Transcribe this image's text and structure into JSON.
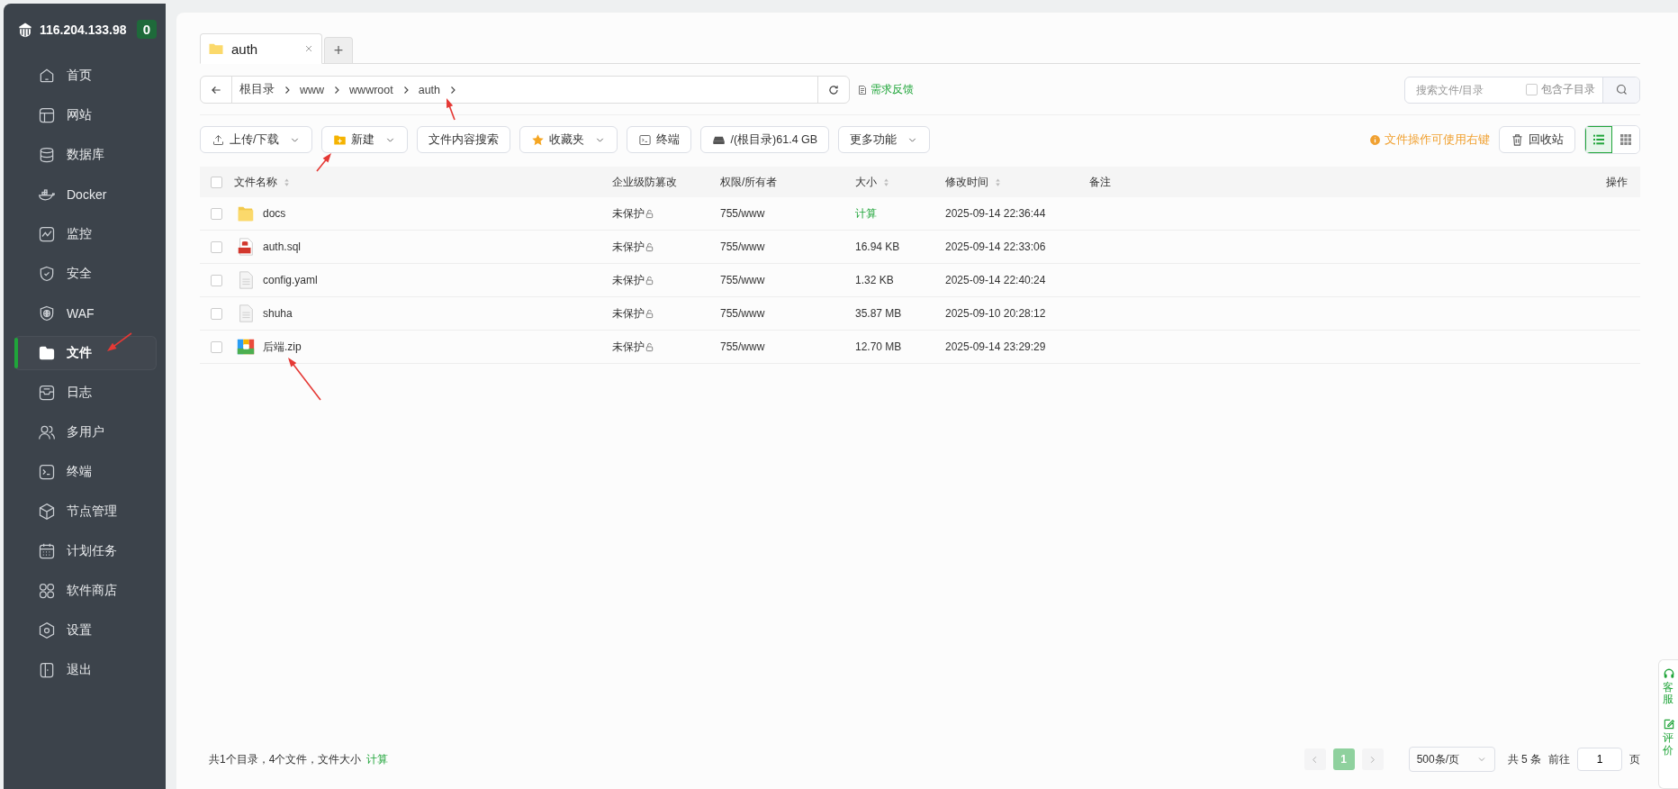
{
  "server": {
    "ip": "116.204.133.98",
    "badge": "0"
  },
  "nav": [
    {
      "label": "首页",
      "selected": false
    },
    {
      "label": "网站",
      "selected": false
    },
    {
      "label": "数据库",
      "selected": false
    },
    {
      "label": "Docker",
      "selected": false
    },
    {
      "label": "监控",
      "selected": false
    },
    {
      "label": "安全",
      "selected": false
    },
    {
      "label": "WAF",
      "selected": false
    },
    {
      "label": "文件",
      "selected": true
    },
    {
      "label": "日志",
      "selected": false
    },
    {
      "label": "多用户",
      "selected": false
    },
    {
      "label": "终端",
      "selected": false
    },
    {
      "label": "节点管理",
      "selected": false
    },
    {
      "label": "计划任务",
      "selected": false
    },
    {
      "label": "软件商店",
      "selected": false
    },
    {
      "label": "设置",
      "selected": false
    },
    {
      "label": "退出",
      "selected": false
    }
  ],
  "tabs": [
    {
      "label": "auth",
      "selected": true
    }
  ],
  "tab_add": "+",
  "breadcrumb": [
    "根目录",
    "www",
    "wwwroot",
    "auth"
  ],
  "feedback": "需求反馈",
  "search": {
    "placeholder": "搜索文件/目录",
    "subdir_label": "包含子目录",
    "subdir_checked": false
  },
  "toolbar": [
    {
      "label": "上传/下载",
      "dropdown": true
    },
    {
      "label": "新建",
      "dropdown": true
    },
    {
      "label": "文件内容搜索",
      "dropdown": false
    },
    {
      "label": "收藏夹",
      "dropdown": true
    },
    {
      "label": "终端",
      "dropdown": false
    },
    {
      "label": "/(根目录)61.4 GB",
      "dropdown": false
    },
    {
      "label": "更多功能",
      "dropdown": true
    }
  ],
  "hint": "文件操作可使用右键",
  "recycle": "回收站",
  "views": [
    {
      "kind": "list",
      "selected": true
    },
    {
      "kind": "grid",
      "selected": false
    }
  ],
  "table": {
    "header_checked": false,
    "columns": [
      {
        "label": "文件名称",
        "sortable": true
      },
      {
        "label": "企业级防篡改",
        "sortable": false
      },
      {
        "label": "权限/所有者",
        "sortable": false
      },
      {
        "label": "大小",
        "sortable": true
      },
      {
        "label": "修改时间",
        "sortable": true
      },
      {
        "label": "备注",
        "sortable": false
      },
      {
        "label": "操作",
        "sortable": false
      }
    ],
    "rows": [
      {
        "checked": false,
        "kind": "folder",
        "name": "docs",
        "protect": "未保护",
        "perm": "755/www",
        "size": "计算",
        "mtime": "2025-09-14 22:36:44"
      },
      {
        "checked": false,
        "kind": "sql",
        "name": "auth.sql",
        "protect": "未保护",
        "perm": "755/www",
        "size": "16.94 KB",
        "mtime": "2025-09-14 22:33:06"
      },
      {
        "checked": false,
        "kind": "file",
        "name": "config.yaml",
        "protect": "未保护",
        "perm": "755/www",
        "size": "1.32 KB",
        "mtime": "2025-09-14 22:40:24"
      },
      {
        "checked": false,
        "kind": "file",
        "name": "shuha",
        "protect": "未保护",
        "perm": "755/www",
        "size": "35.87 MB",
        "mtime": "2025-09-10 20:28:12"
      },
      {
        "checked": false,
        "kind": "zip",
        "name": "后端.zip",
        "protect": "未保护",
        "perm": "755/www",
        "size": "12.70 MB",
        "mtime": "2025-09-14 23:29:29"
      }
    ]
  },
  "footer": {
    "summary": "共1个目录，4个文件，文件大小",
    "calc": "计算"
  },
  "pager": {
    "pages": [
      {
        "label": "1",
        "selected": true
      }
    ],
    "page_size": "500条/页",
    "total": "共 5 条",
    "goto": "前往",
    "goto_value": "1",
    "unit": "页"
  },
  "float_buttons": [
    {
      "label": "客服"
    },
    {
      "label": "评价"
    }
  ]
}
